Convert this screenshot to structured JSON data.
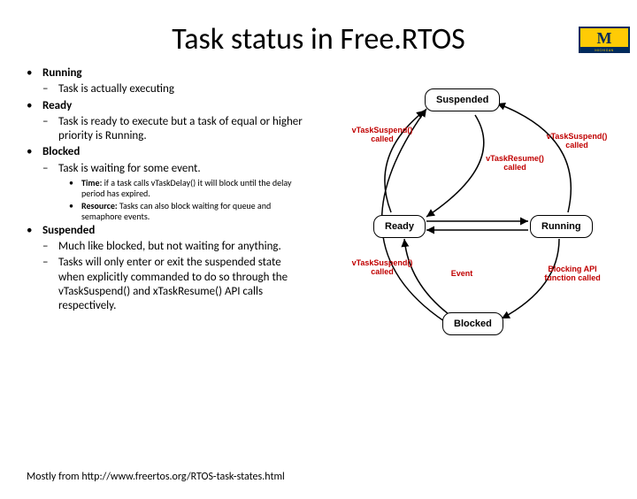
{
  "title": "Task status in Free.RTOS",
  "logo_letter": "M",
  "states": {
    "running": {
      "name": "Running",
      "sub1": "Task is actually executing"
    },
    "ready": {
      "name": "Ready",
      "sub1": "Task is ready to execute but a task of equal or higher priority is Running."
    },
    "blocked": {
      "name": "Blocked",
      "sub1": "Task is waiting for some event.",
      "time_label": "Time:",
      "time_text": " if a task calls vTaskDelay() it will block until the delay period has expired.",
      "res_label": "Resource:",
      "res_text": " Tasks can also block waiting for queue and semaphore events."
    },
    "suspended": {
      "name": "Suspended",
      "sub1": "Much like blocked, but not waiting for anything.",
      "sub2": "Tasks will only enter or exit the suspended state when explicitly commanded to do so through the vTaskSuspend() and xTaskResume() API calls respectively."
    }
  },
  "diagram": {
    "nodes": {
      "suspended": "Suspended",
      "ready": "Ready",
      "running": "Running",
      "blocked": "Blocked"
    },
    "labels": {
      "suspend_called": "vTaskSuspend() called",
      "suspend_called2": "vTaskSuspend() called",
      "suspend_called3": "vTaskSuspend() called",
      "resume_called": "vTaskResume() called",
      "event": "Event",
      "blocking_api": "Blocking API function called"
    }
  },
  "footer": "Mostly from http://www.freertos.org/RTOS-task-states.html"
}
